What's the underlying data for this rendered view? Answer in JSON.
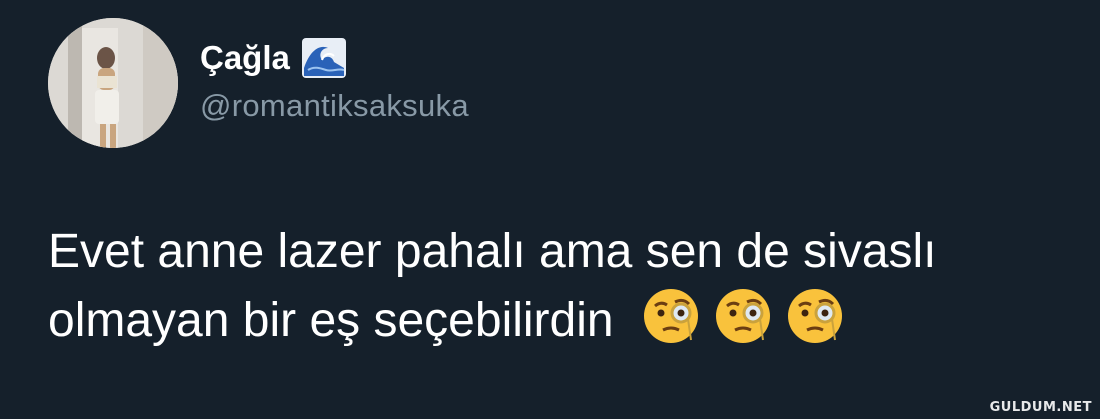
{
  "user": {
    "display_name": "Çağla",
    "handle": "@romantiksaksuka",
    "name_icon": "water-wave-icon",
    "avatar_icon": "profile-photo"
  },
  "tweet": {
    "line1": "Evet anne lazer pahalı ama sen de sivaslı",
    "line2": "olmayan bir eş seçebilirdin",
    "emojis": [
      "face-with-monocle-icon",
      "face-with-monocle-icon",
      "face-with-monocle-icon"
    ]
  },
  "watermark": "GULDUM.NET",
  "colors": {
    "background": "#15202b",
    "text": "#ffffff",
    "handle": "#8899a6"
  }
}
